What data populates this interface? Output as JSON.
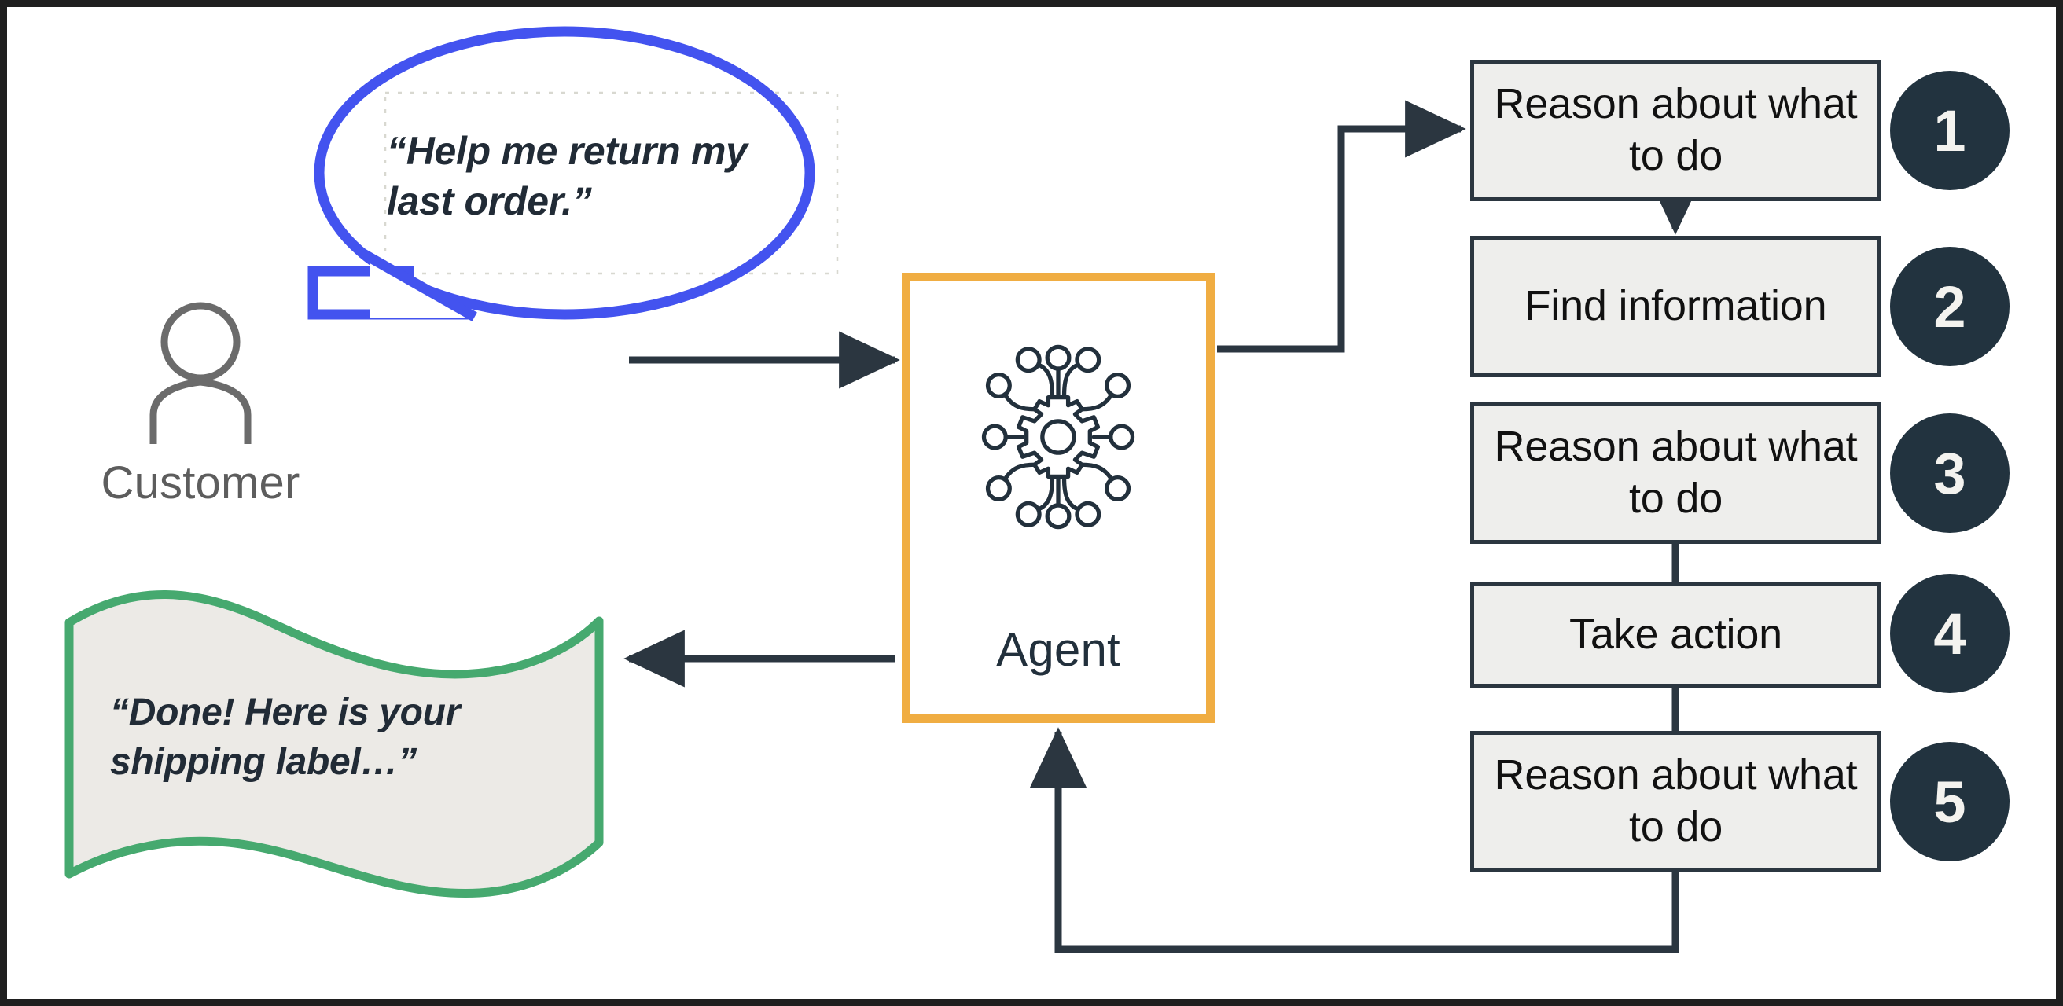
{
  "diagram": {
    "title": "Agent loop diagram",
    "colors": {
      "agent_border": "#f0ad42",
      "bubble_stroke": "#4353ef",
      "banner_stroke": "#46a96f",
      "banner_fill": "#eceae6",
      "badge_fill": "#22333f",
      "connector": "#2b3640",
      "step_fill": "#eeeeec",
      "step_border": "#2b3640",
      "customer_icon": "#6b6b6b",
      "frame": "#1f1f1f"
    }
  },
  "customer": {
    "label": "Customer",
    "icon": "person-icon"
  },
  "customer_message": {
    "text": "“Help me return my last order.”",
    "shape": "speech-bubble"
  },
  "agent_response": {
    "text": "“Done! Here is your shipping label…”",
    "shape": "wavy-banner"
  },
  "agent": {
    "label": "Agent",
    "icon": "gear-network-icon"
  },
  "steps": [
    {
      "number": "1",
      "label": "Reason about what to do"
    },
    {
      "number": "2",
      "label": "Find information"
    },
    {
      "number": "3",
      "label": "Reason about what to do"
    },
    {
      "number": "4",
      "label": "Take action"
    },
    {
      "number": "5",
      "label": "Reason about what to do"
    }
  ]
}
